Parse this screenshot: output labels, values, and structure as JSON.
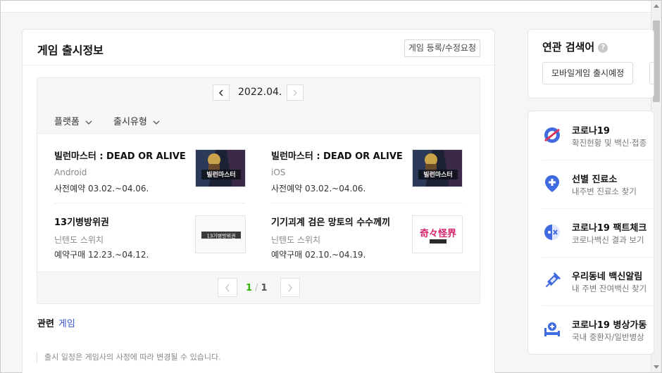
{
  "release_info": {
    "title": "게임 출시정보",
    "request_button": "게임 등록/수정요청",
    "month": "2022.04.",
    "filters": [
      "플랫폼",
      "출시유형"
    ],
    "games": [
      {
        "title": "빌런마스터 : DEAD OR ALIVE",
        "platform": "Android",
        "date": "사전예약  03.02.~04.06."
      },
      {
        "title": "빌런마스터 : DEAD OR ALIVE",
        "platform": "iOS",
        "date": "사전예약  03.02.~04.06."
      },
      {
        "title": "13기병방위권",
        "platform": "닌텐도 스위치",
        "date": "예약구매  12.23.~04.12."
      },
      {
        "title": "기기괴계 검은 망토의 수수께끼",
        "platform": "닌텐도 스위치",
        "date": "예약구매  02.10.~04.19."
      }
    ],
    "thumb_texts": [
      "빌런마스터",
      "빌런마스터",
      "13기병방위권",
      "奇々怪界"
    ],
    "pager": {
      "current": "1",
      "separator": "/",
      "total": "1"
    },
    "related_label": "관련",
    "related_link": "게임",
    "notice": "출시 일정은 게임사의 사정에 따라 변경될 수 있습니다."
  },
  "related_search": {
    "title": "연관 검색어",
    "help": "?",
    "keywords": [
      "모바일게임 출시예정"
    ]
  },
  "services": [
    {
      "name": "코로나19",
      "desc": "확진현황 및 백신·접종",
      "icon": "virus-icon"
    },
    {
      "name": "선별 진료소",
      "desc": "내주변 진료소 찾기",
      "icon": "location-pin-icon"
    },
    {
      "name": "코로나19 팩트체크",
      "desc": "코로나백신 결과 보기",
      "icon": "fact-check-icon"
    },
    {
      "name": "우리동네 백신알림",
      "desc": "내 주변 잔여백신 찾기",
      "icon": "syringe-icon"
    },
    {
      "name": "코로나19 병상가동",
      "desc": "국내 중환자/일반병상",
      "icon": "hospital-bed-icon"
    }
  ],
  "colors": {
    "accent_green": "#2db400",
    "link_blue": "#3557c5",
    "icon_blue": "#3f6ae0"
  }
}
